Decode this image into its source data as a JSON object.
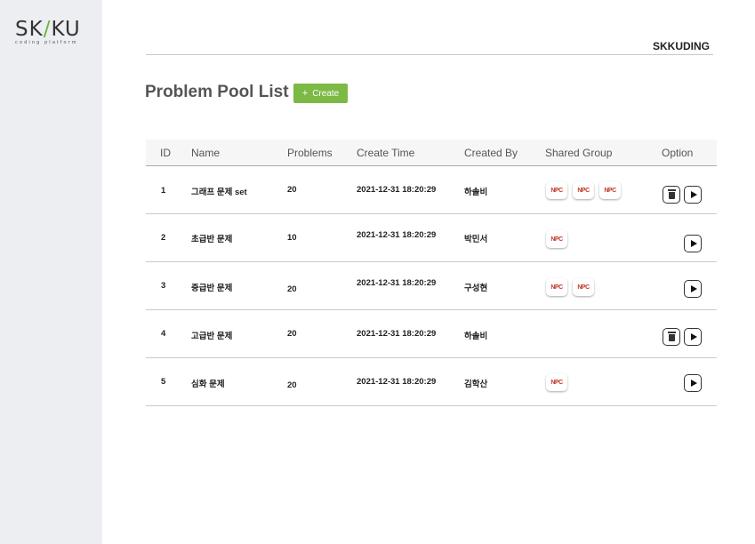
{
  "logo": {
    "part1": "SK",
    "slash": "/",
    "part2": "KU",
    "tagline": "coding platform"
  },
  "header": {
    "brand": "SKKUDING"
  },
  "page": {
    "title": "Problem Pool List",
    "create_label": "Create",
    "create_icon": "plus-icon"
  },
  "table": {
    "columns": [
      "ID",
      "Name",
      "Problems",
      "Create Time",
      "Created By",
      "Shared Group",
      "Option"
    ],
    "rows": [
      {
        "id": "1",
        "name": "그래프 문제 set",
        "problems": "20",
        "create_time": "2021-12-31 18:20:29",
        "created_by": "하솔비",
        "groups": [
          "NPC",
          "NPC",
          "NPC"
        ],
        "deletable": true
      },
      {
        "id": "2",
        "name": "초급반 문제",
        "problems": "10",
        "create_time": "2021-12-31 18:20:29",
        "created_by": "박민서",
        "groups": [
          "NPC"
        ],
        "deletable": false
      },
      {
        "id": "3",
        "name": "중급반 문제",
        "problems": "20",
        "create_time": "2021-12-31 18:20:29",
        "created_by": "구성현",
        "groups": [
          "NPC",
          "NPC"
        ],
        "deletable": false
      },
      {
        "id": "4",
        "name": "고급반 문제",
        "problems": "20",
        "create_time": "2021-12-31 18:20:29",
        "created_by": "하솔비",
        "groups": [],
        "deletable": true
      },
      {
        "id": "5",
        "name": "심화 문제",
        "problems": "20",
        "create_time": "2021-12-31 18:20:29",
        "created_by": "김학산",
        "groups": [
          "NPC"
        ],
        "deletable": false
      }
    ]
  },
  "colors": {
    "accent": "#7cba45",
    "sidebar": "#eceef2",
    "badge_text": "#c0392b"
  }
}
